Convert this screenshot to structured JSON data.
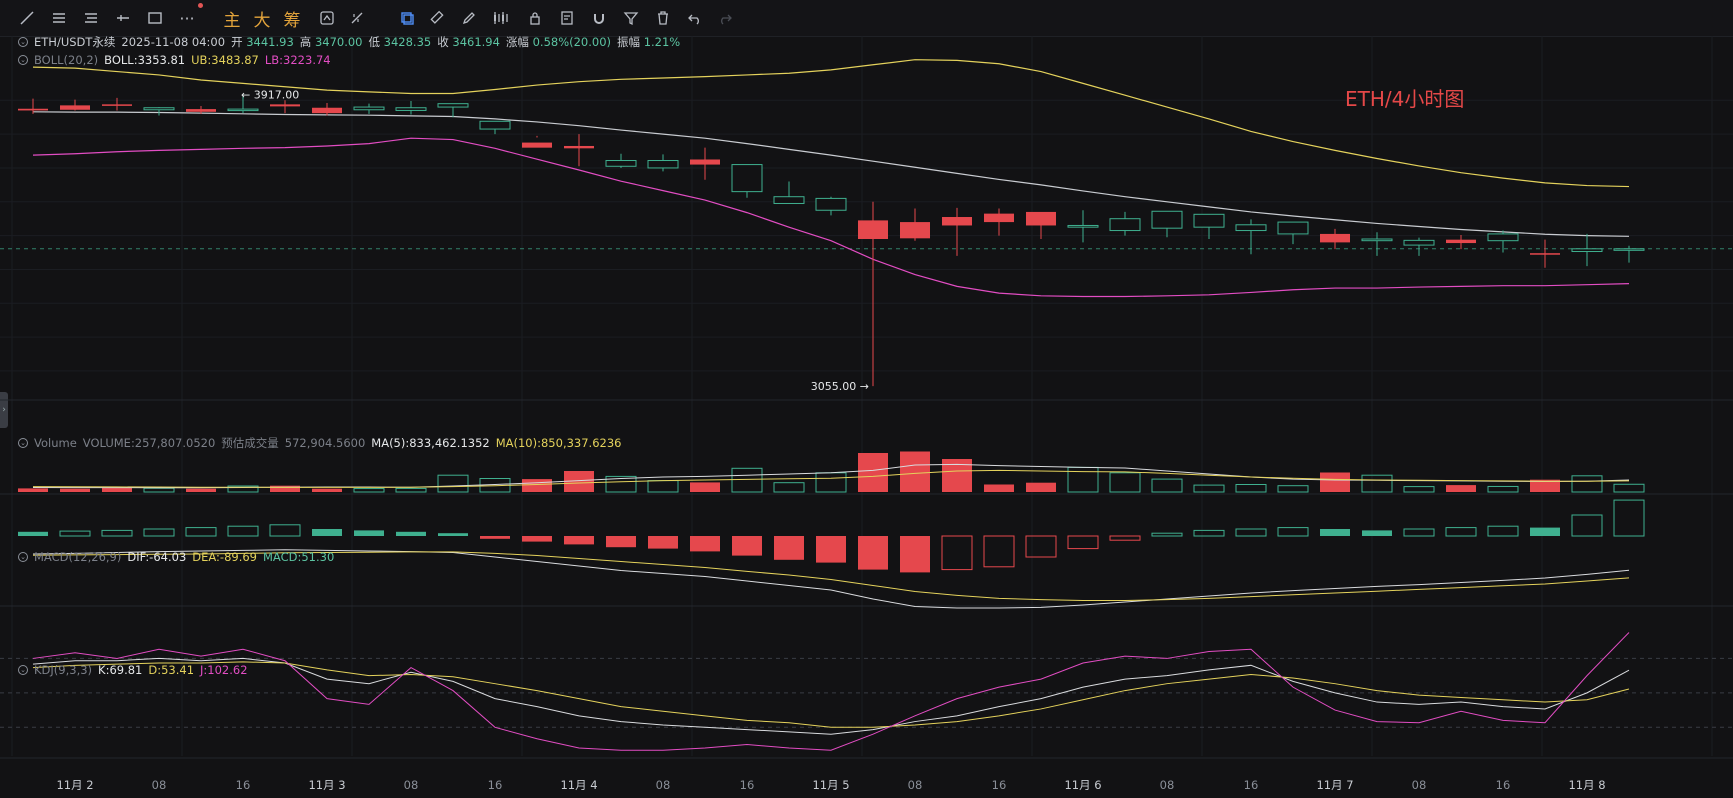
{
  "toolbar": {
    "icons": [
      "trend-line-icon",
      "horizontal-lines-icon",
      "parallel-lines-icon",
      "cross-line-icon",
      "rectangle-icon",
      "more-icon",
      "main-label",
      "big-label",
      "chips-label",
      "formula-icon",
      "measure-icon",
      "layers-icon",
      "ruler-icon",
      "pencil-icon",
      "candle-icon",
      "lock-icon",
      "note-icon",
      "magnet-icon",
      "filter-icon",
      "trash-icon",
      "undo-icon",
      "redo-icon"
    ],
    "cjk_labels": {
      "main": "主",
      "big": "大",
      "chips": "筹"
    }
  },
  "header": {
    "symbol": "ETH/USDT永续",
    "time": "2025-11-08 04:00",
    "open_label": "开",
    "open": "3441.93",
    "high_label": "高",
    "high": "3470.00",
    "low_label": "低",
    "low": "3428.35",
    "close_label": "收",
    "close": "3461.94",
    "change_label": "涨幅",
    "change": "0.58%(20.00)",
    "amp_label": "振幅",
    "amp": "1.21%"
  },
  "boll": {
    "name": "BOLL(20,2)",
    "boll": "BOLL:3353.81",
    "ub": "UB:3483.87",
    "lb": "LB:3223.74"
  },
  "volume_legend": {
    "name": "Volume",
    "volume": "VOLUME:257,807.0520",
    "pred_label": "预估成交量",
    "pred": "572,904.5600",
    "ma5": "MA(5):833,462.1352",
    "ma10": "MA(10):850,337.6236"
  },
  "macd_legend": {
    "name": "MACD(12,26,9)",
    "dif": "DIF:-64.03",
    "dea": "DEA:-89.69",
    "macd": "MACD:51.30"
  },
  "kdj_legend": {
    "name": "KDJ(9,3,3)",
    "k": "K:69.81",
    "d": "D:53.41",
    "j": "J:102.62"
  },
  "annotation": "ETH/4小时图",
  "colors": {
    "up": "#3fb08f",
    "down": "#e5484d",
    "boll_mid": "#c9ccd1",
    "boll_ub": "#e4d25c",
    "boll_lb": "#e24dc3"
  },
  "chart_data": [
    {
      "type": "candlestick",
      "name": "ETH/USDT永续 4H",
      "x": [
        "11-01 20:00",
        "11-02 00:00",
        "11-02 04:00",
        "11-02 08:00",
        "11-02 12:00",
        "11-02 16:00",
        "11-02 20:00",
        "11-03 00:00",
        "11-03 04:00",
        "11-03 08:00",
        "11-03 12:00",
        "11-03 16:00",
        "11-03 20:00",
        "11-04 00:00",
        "11-04 04:00",
        "11-04 08:00",
        "11-04 12:00",
        "11-04 16:00",
        "11-04 20:00",
        "11-05 00:00",
        "11-05 04:00",
        "11-05 08:00",
        "11-05 12:00",
        "11-05 16:00",
        "11-05 20:00",
        "11-06 00:00",
        "11-06 04:00",
        "11-06 08:00",
        "11-06 12:00",
        "11-06 16:00",
        "11-06 20:00",
        "11-07 00:00",
        "11-07 04:00",
        "11-07 08:00",
        "11-07 12:00",
        "11-07 16:00",
        "11-07 20:00",
        "11-08 00:00",
        "11-08 04:00"
      ],
      "x_tick_labels": [
        "11月 2",
        "08",
        "16",
        "11月 3",
        "08",
        "16",
        "11月 4",
        "08",
        "16",
        "11月 5",
        "08",
        "16",
        "11月 6",
        "08",
        "16",
        "11月 7",
        "08",
        "16",
        "11月 8"
      ],
      "open": [
        3875,
        3885,
        3888,
        3872,
        3874,
        3870,
        3888,
        3878,
        3872,
        3870,
        3880,
        3815,
        3775,
        3765,
        3705,
        3700,
        3725,
        3630,
        3595,
        3575,
        3545,
        3540,
        3555,
        3565,
        3570,
        3525,
        3515,
        3522,
        3525,
        3515,
        3505,
        3505,
        3485,
        3472,
        3488,
        3485,
        3448,
        3453,
        3461
      ],
      "high": [
        3905,
        3902,
        3907,
        3880,
        3883,
        3917,
        3900,
        3892,
        3890,
        3898,
        3890,
        3825,
        3790,
        3800,
        3742,
        3740,
        3760,
        3702,
        3660,
        3615,
        3600,
        3580,
        3582,
        3580,
        3565,
        3575,
        3570,
        3565,
        3558,
        3548,
        3525,
        3520,
        3510,
        3494,
        3502,
        3515,
        3488,
        3505,
        3470
      ],
      "low": [
        3860,
        3870,
        3870,
        3855,
        3860,
        3862,
        3862,
        3855,
        3860,
        3858,
        3850,
        3800,
        3795,
        3705,
        3700,
        3690,
        3665,
        3612,
        3598,
        3560,
        3055,
        3485,
        3440,
        3500,
        3490,
        3480,
        3500,
        3495,
        3490,
        3445,
        3475,
        3460,
        3440,
        3440,
        3460,
        3450,
        3405,
        3410,
        3420
      ],
      "close": [
        3870,
        3872,
        3885,
        3878,
        3866,
        3874,
        3882,
        3862,
        3880,
        3878,
        3890,
        3838,
        3760,
        3758,
        3722,
        3722,
        3710,
        3710,
        3615,
        3610,
        3490,
        3492,
        3530,
        3540,
        3530,
        3530,
        3550,
        3572,
        3563,
        3532,
        3540,
        3480,
        3490,
        3486,
        3478,
        3505,
        3447,
        3461,
        3461
      ],
      "ylim": [
        3020,
        3960
      ],
      "annotations": [
        {
          "text": "3917.00",
          "value": 3917
        },
        {
          "text": "3055.00",
          "value": 3055
        }
      ],
      "boll_mid_values": [
        3866,
        3865,
        3865,
        3864,
        3862,
        3860,
        3858,
        3857,
        3856,
        3854,
        3852,
        3845,
        3836,
        3825,
        3812,
        3800,
        3788,
        3772,
        3755,
        3738,
        3720,
        3702,
        3684,
        3666,
        3650,
        3632,
        3615,
        3600,
        3585,
        3570,
        3558,
        3547,
        3536,
        3527,
        3518,
        3511,
        3504,
        3500,
        3498
      ],
      "boll_ub_values": [
        3998,
        3995,
        3985,
        3975,
        3960,
        3950,
        3940,
        3930,
        3925,
        3920,
        3920,
        3932,
        3945,
        3955,
        3962,
        3966,
        3970,
        3975,
        3980,
        3990,
        4005,
        4020,
        4018,
        4008,
        3985,
        3950,
        3915,
        3880,
        3845,
        3808,
        3778,
        3752,
        3728,
        3706,
        3686,
        3670,
        3656,
        3648,
        3645
      ],
      "boll_lb_values": [
        3738,
        3742,
        3748,
        3752,
        3755,
        3758,
        3760,
        3765,
        3772,
        3788,
        3784,
        3758,
        3726,
        3694,
        3661,
        3633,
        3605,
        3568,
        3525,
        3485,
        3430,
        3385,
        3350,
        3330,
        3322,
        3320,
        3320,
        3322,
        3325,
        3332,
        3340,
        3345,
        3345,
        3348,
        3350,
        3352,
        3352,
        3355,
        3358
      ]
    },
    {
      "type": "bar",
      "name": "Volume",
      "values": [
        120000,
        110000,
        150000,
        125000,
        110000,
        200000,
        210000,
        110000,
        115000,
        120000,
        560000,
        450000,
        430000,
        700000,
        520000,
        380000,
        320000,
        790000,
        310000,
        640000,
        1300000,
        1350000,
        1100000,
        250000,
        310000,
        820000,
        640000,
        430000,
        230000,
        250000,
        210000,
        650000,
        560000,
        180000,
        230000,
        185000,
        410000,
        540000,
        258000
      ],
      "ma5_values": [
        150000,
        145000,
        145000,
        142000,
        140000,
        150000,
        160000,
        165000,
        165000,
        160000,
        200000,
        250000,
        310000,
        380000,
        450000,
        500000,
        520000,
        560000,
        600000,
        640000,
        720000,
        900000,
        920000,
        880000,
        850000,
        820000,
        800000,
        700000,
        600000,
        500000,
        430000,
        400000,
        390000,
        380000,
        370000,
        360000,
        350000,
        360000,
        400000
      ],
      "ma10_values": [
        180000,
        175000,
        170000,
        165000,
        160000,
        158000,
        155000,
        155000,
        155000,
        158000,
        180000,
        210000,
        250000,
        300000,
        340000,
        380000,
        400000,
        420000,
        440000,
        460000,
        520000,
        620000,
        700000,
        720000,
        700000,
        680000,
        670000,
        620000,
        560000,
        500000,
        460000,
        420000,
        400000,
        390000,
        380000,
        370000,
        360000,
        360000,
        370000
      ]
    },
    {
      "type": "bar",
      "name": "MACD(12,26,9)",
      "values": [
        6,
        7,
        8,
        10,
        12,
        14,
        16,
        10,
        8,
        6,
        4,
        -4,
        -8,
        -12,
        -16,
        -18,
        -22,
        -28,
        -34,
        -38,
        -48,
        -52,
        -48,
        -44,
        -30,
        -18,
        -6,
        4,
        8,
        10,
        12,
        10,
        8,
        10,
        12,
        14,
        12,
        30,
        51.3
      ],
      "dif_values": [
        -10,
        -8,
        -5,
        -2,
        0,
        2,
        4,
        2,
        0,
        -2,
        -5,
        -20,
        -35,
        -50,
        -65,
        -75,
        -85,
        -100,
        -115,
        -130,
        -160,
        -185,
        -190,
        -190,
        -188,
        -180,
        -170,
        -160,
        -150,
        -140,
        -132,
        -125,
        -118,
        -112,
        -105,
        -98,
        -90,
        -78,
        -64
      ],
      "dea_values": [
        -14,
        -13,
        -12,
        -11,
        -10,
        -8,
        -6,
        -5,
        -4,
        -3,
        -3,
        -8,
        -15,
        -25,
        -35,
        -45,
        -55,
        -68,
        -80,
        -95,
        -115,
        -135,
        -148,
        -158,
        -162,
        -165,
        -165,
        -162,
        -158,
        -152,
        -146,
        -140,
        -134,
        -128,
        -122,
        -116,
        -110,
        -100,
        -89.7
      ]
    },
    {
      "type": "line",
      "name": "KDJ(9,3,3)",
      "k_values": [
        75,
        78,
        78,
        80,
        78,
        80,
        76,
        62,
        58,
        68,
        60,
        45,
        38,
        30,
        25,
        22,
        20,
        18,
        16,
        14,
        18,
        25,
        30,
        38,
        45,
        55,
        62,
        65,
        70,
        74,
        60,
        50,
        42,
        40,
        42,
        38,
        36,
        50,
        69.81
      ],
      "d_values": [
        72,
        74,
        75,
        76,
        76,
        77,
        76,
        70,
        65,
        66,
        64,
        58,
        52,
        45,
        38,
        34,
        30,
        26,
        24,
        20,
        20,
        22,
        25,
        30,
        36,
        44,
        52,
        58,
        62,
        66,
        63,
        58,
        52,
        48,
        46,
        44,
        42,
        44,
        53.41
      ],
      "j_values": [
        80,
        85,
        80,
        88,
        82,
        88,
        78,
        45,
        40,
        72,
        52,
        20,
        10,
        2,
        0,
        0,
        2,
        5,
        2,
        0,
        14,
        30,
        45,
        55,
        62,
        76,
        82,
        80,
        86,
        88,
        55,
        35,
        25,
        24,
        34,
        26,
        24,
        65,
        102.62
      ],
      "ref_lines": [
        80,
        50,
        20
      ]
    }
  ]
}
